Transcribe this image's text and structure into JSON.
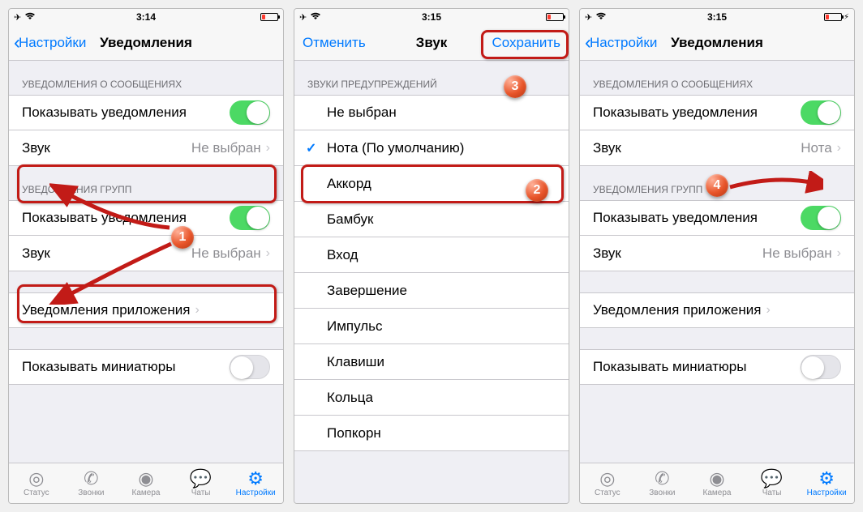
{
  "status": {
    "time1": "3:14",
    "time2": "3:15",
    "time3": "3:15"
  },
  "panel1": {
    "nav": {
      "back": "Настройки",
      "title": "Уведомления"
    },
    "section1": {
      "header": "УВЕДОМЛЕНИЯ О СООБЩЕНИЯХ",
      "show": "Показывать уведомления",
      "sound": "Звук",
      "sound_val": "Не выбран"
    },
    "section2": {
      "header": "УВЕДОМЛЕНИЯ ГРУПП",
      "show": "Показывать уведомления",
      "sound": "Звук",
      "sound_val": "Не выбран"
    },
    "app_notif": "Уведомления приложения",
    "thumbnails": "Показывать миниатюры"
  },
  "panel2": {
    "nav": {
      "cancel": "Отменить",
      "title": "Звук",
      "save": "Сохранить"
    },
    "header": "ЗВУКИ ПРЕДУПРЕЖДЕНИЙ",
    "items": [
      "Не выбран",
      "Нота (По умолчанию)",
      "Аккорд",
      "Бамбук",
      "Вход",
      "Завершение",
      "Импульс",
      "Клавиши",
      "Кольца",
      "Попкорн"
    ]
  },
  "panel3": {
    "nav": {
      "back": "Настройки",
      "title": "Уведомления"
    },
    "section1": {
      "header": "УВЕДОМЛЕНИЯ О СООБЩЕНИЯХ",
      "show": "Показывать уведомления",
      "sound": "Звук",
      "sound_val": "Нота"
    },
    "section2": {
      "header": "УВЕДОМЛЕНИЯ ГРУПП",
      "show": "Показывать уведомления",
      "sound": "Звук",
      "sound_val": "Не выбран"
    },
    "app_notif": "Уведомления приложения",
    "thumbnails": "Показывать миниатюры"
  },
  "tabs": {
    "status": "Статус",
    "calls": "Звонки",
    "camera": "Камера",
    "chats": "Чаты",
    "settings": "Настройки"
  },
  "badges": {
    "n1": "1",
    "n2": "2",
    "n3": "3",
    "n4": "4"
  }
}
